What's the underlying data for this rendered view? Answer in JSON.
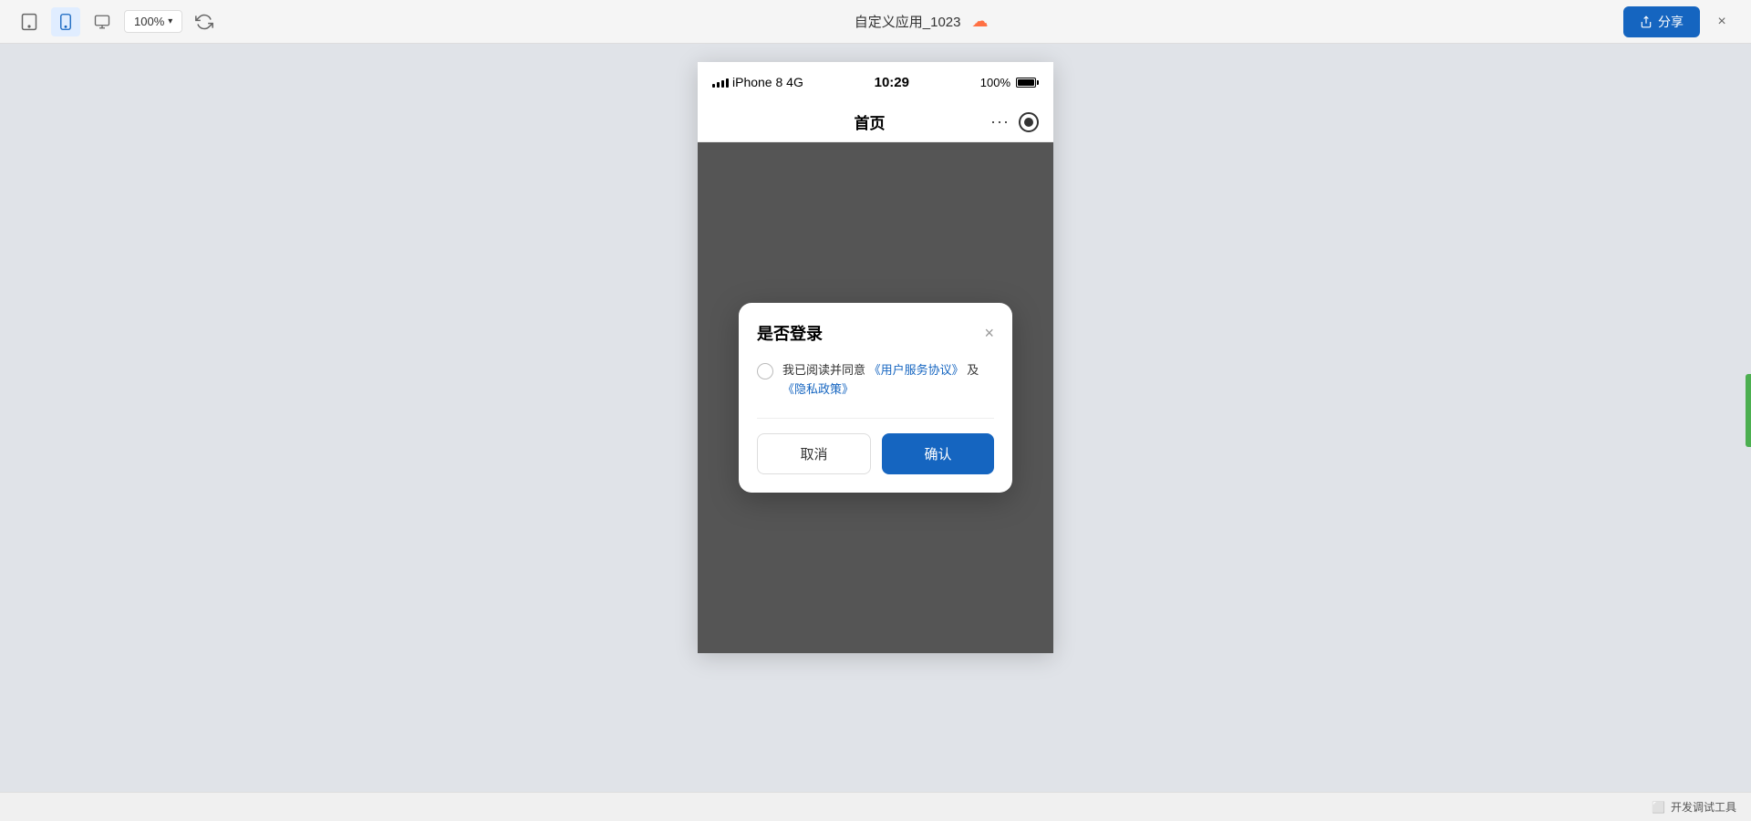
{
  "toolbar": {
    "title": "自定义应用_1023",
    "zoom": "100%",
    "share_label": "分享",
    "close_label": "×",
    "device_label": "iPhone 8  4G"
  },
  "statusBar": {
    "signal_label": "信号",
    "model": "iPhone 8  4G",
    "time": "10:29",
    "battery": "100%"
  },
  "navbar": {
    "title": "首页",
    "dots": "···"
  },
  "dialog": {
    "title": "是否登录",
    "agreement_prefix": "我已阅读并同意",
    "link1": "《用户服务协议》",
    "connector": "及",
    "link2": "《隐私政策》",
    "cancel_label": "取消",
    "confirm_label": "确认"
  },
  "bottomBar": {
    "devtools_icon": "□",
    "devtools_label": "开发调试工具"
  }
}
